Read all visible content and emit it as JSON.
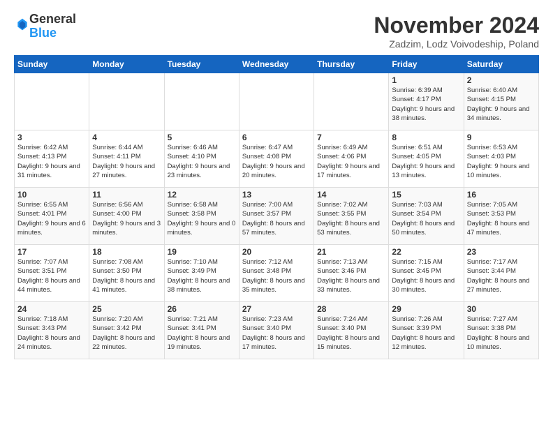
{
  "header": {
    "logo_general": "General",
    "logo_blue": "Blue",
    "month_title": "November 2024",
    "location": "Zadzim, Lodz Voivodeship, Poland"
  },
  "weekdays": [
    "Sunday",
    "Monday",
    "Tuesday",
    "Wednesday",
    "Thursday",
    "Friday",
    "Saturday"
  ],
  "weeks": [
    [
      {
        "day": "",
        "info": ""
      },
      {
        "day": "",
        "info": ""
      },
      {
        "day": "",
        "info": ""
      },
      {
        "day": "",
        "info": ""
      },
      {
        "day": "",
        "info": ""
      },
      {
        "day": "1",
        "info": "Sunrise: 6:39 AM\nSunset: 4:17 PM\nDaylight: 9 hours\nand 38 minutes."
      },
      {
        "day": "2",
        "info": "Sunrise: 6:40 AM\nSunset: 4:15 PM\nDaylight: 9 hours\nand 34 minutes."
      }
    ],
    [
      {
        "day": "3",
        "info": "Sunrise: 6:42 AM\nSunset: 4:13 PM\nDaylight: 9 hours\nand 31 minutes."
      },
      {
        "day": "4",
        "info": "Sunrise: 6:44 AM\nSunset: 4:11 PM\nDaylight: 9 hours\nand 27 minutes."
      },
      {
        "day": "5",
        "info": "Sunrise: 6:46 AM\nSunset: 4:10 PM\nDaylight: 9 hours\nand 23 minutes."
      },
      {
        "day": "6",
        "info": "Sunrise: 6:47 AM\nSunset: 4:08 PM\nDaylight: 9 hours\nand 20 minutes."
      },
      {
        "day": "7",
        "info": "Sunrise: 6:49 AM\nSunset: 4:06 PM\nDaylight: 9 hours\nand 17 minutes."
      },
      {
        "day": "8",
        "info": "Sunrise: 6:51 AM\nSunset: 4:05 PM\nDaylight: 9 hours\nand 13 minutes."
      },
      {
        "day": "9",
        "info": "Sunrise: 6:53 AM\nSunset: 4:03 PM\nDaylight: 9 hours\nand 10 minutes."
      }
    ],
    [
      {
        "day": "10",
        "info": "Sunrise: 6:55 AM\nSunset: 4:01 PM\nDaylight: 9 hours\nand 6 minutes."
      },
      {
        "day": "11",
        "info": "Sunrise: 6:56 AM\nSunset: 4:00 PM\nDaylight: 9 hours\nand 3 minutes."
      },
      {
        "day": "12",
        "info": "Sunrise: 6:58 AM\nSunset: 3:58 PM\nDaylight: 9 hours\nand 0 minutes."
      },
      {
        "day": "13",
        "info": "Sunrise: 7:00 AM\nSunset: 3:57 PM\nDaylight: 8 hours\nand 57 minutes."
      },
      {
        "day": "14",
        "info": "Sunrise: 7:02 AM\nSunset: 3:55 PM\nDaylight: 8 hours\nand 53 minutes."
      },
      {
        "day": "15",
        "info": "Sunrise: 7:03 AM\nSunset: 3:54 PM\nDaylight: 8 hours\nand 50 minutes."
      },
      {
        "day": "16",
        "info": "Sunrise: 7:05 AM\nSunset: 3:53 PM\nDaylight: 8 hours\nand 47 minutes."
      }
    ],
    [
      {
        "day": "17",
        "info": "Sunrise: 7:07 AM\nSunset: 3:51 PM\nDaylight: 8 hours\nand 44 minutes."
      },
      {
        "day": "18",
        "info": "Sunrise: 7:08 AM\nSunset: 3:50 PM\nDaylight: 8 hours\nand 41 minutes."
      },
      {
        "day": "19",
        "info": "Sunrise: 7:10 AM\nSunset: 3:49 PM\nDaylight: 8 hours\nand 38 minutes."
      },
      {
        "day": "20",
        "info": "Sunrise: 7:12 AM\nSunset: 3:48 PM\nDaylight: 8 hours\nand 35 minutes."
      },
      {
        "day": "21",
        "info": "Sunrise: 7:13 AM\nSunset: 3:46 PM\nDaylight: 8 hours\nand 33 minutes."
      },
      {
        "day": "22",
        "info": "Sunrise: 7:15 AM\nSunset: 3:45 PM\nDaylight: 8 hours\nand 30 minutes."
      },
      {
        "day": "23",
        "info": "Sunrise: 7:17 AM\nSunset: 3:44 PM\nDaylight: 8 hours\nand 27 minutes."
      }
    ],
    [
      {
        "day": "24",
        "info": "Sunrise: 7:18 AM\nSunset: 3:43 PM\nDaylight: 8 hours\nand 24 minutes."
      },
      {
        "day": "25",
        "info": "Sunrise: 7:20 AM\nSunset: 3:42 PM\nDaylight: 8 hours\nand 22 minutes."
      },
      {
        "day": "26",
        "info": "Sunrise: 7:21 AM\nSunset: 3:41 PM\nDaylight: 8 hours\nand 19 minutes."
      },
      {
        "day": "27",
        "info": "Sunrise: 7:23 AM\nSunset: 3:40 PM\nDaylight: 8 hours\nand 17 minutes."
      },
      {
        "day": "28",
        "info": "Sunrise: 7:24 AM\nSunset: 3:40 PM\nDaylight: 8 hours\nand 15 minutes."
      },
      {
        "day": "29",
        "info": "Sunrise: 7:26 AM\nSunset: 3:39 PM\nDaylight: 8 hours\nand 12 minutes."
      },
      {
        "day": "30",
        "info": "Sunrise: 7:27 AM\nSunset: 3:38 PM\nDaylight: 8 hours\nand 10 minutes."
      }
    ]
  ]
}
